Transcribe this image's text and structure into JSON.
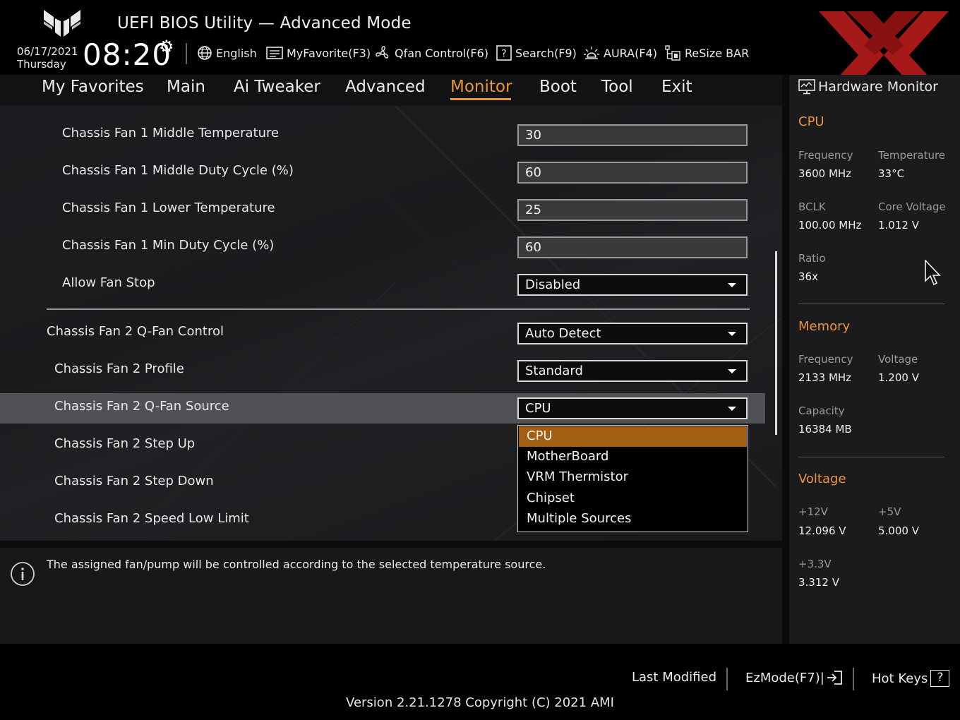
{
  "header": {
    "title": "UEFI BIOS Utility — Advanced Mode",
    "date": "06/17/2021",
    "day": "Thursday",
    "time": "08:20",
    "tools": [
      {
        "label": "English",
        "icon": "globe-icon"
      },
      {
        "label": "MyFavorite(F3)",
        "icon": "favorite-list-icon"
      },
      {
        "label": "Qfan Control(F6)",
        "icon": "fan-icon"
      },
      {
        "label": "Search(F9)",
        "icon": "search-help-icon"
      },
      {
        "label": "AURA(F4)",
        "icon": "aura-light-icon"
      },
      {
        "label": "ReSize BAR",
        "icon": "resize-bar-icon"
      }
    ]
  },
  "nav": {
    "tabs": [
      "My Favorites",
      "Main",
      "Ai Tweaker",
      "Advanced",
      "Monitor",
      "Boot",
      "Tool",
      "Exit"
    ],
    "active": "Monitor"
  },
  "settings": {
    "fan1": [
      {
        "label": "Chassis Fan 1 Middle Temperature",
        "value": "30",
        "kind": "text"
      },
      {
        "label": "Chassis Fan 1 Middle Duty Cycle (%)",
        "value": "60",
        "kind": "text"
      },
      {
        "label": "Chassis Fan 1 Lower Temperature",
        "value": "25",
        "kind": "text"
      },
      {
        "label": "Chassis Fan 1 Min Duty Cycle (%)",
        "value": "60",
        "kind": "text"
      },
      {
        "label": "Allow Fan Stop",
        "value": "Disabled",
        "kind": "select"
      }
    ],
    "fan2_control": {
      "label": "Chassis Fan 2 Q-Fan Control",
      "value": "Auto Detect"
    },
    "fan2_profile": {
      "label": "Chassis Fan 2 Profile",
      "value": "Standard"
    },
    "fan2_source": {
      "label": "Chassis Fan 2 Q-Fan Source",
      "value": "CPU"
    },
    "fan2_step_up": {
      "label": "Chassis Fan 2 Step Up"
    },
    "fan2_step_down": {
      "label": "Chassis Fan 2 Step Down"
    },
    "fan2_speed_low": {
      "label": "Chassis Fan 2 Speed Low Limit"
    }
  },
  "dropdown": {
    "options": [
      "CPU",
      "MotherBoard",
      "VRM Thermistor",
      "Chipset",
      "Multiple Sources"
    ],
    "selected": "CPU"
  },
  "help": {
    "text": "The assigned fan/pump will be controlled according to the selected temperature source."
  },
  "hardware_monitor": {
    "title": "Hardware Monitor",
    "cpu": {
      "heading": "CPU",
      "frequency_label": "Frequency",
      "frequency": "3600 MHz",
      "temperature_label": "Temperature",
      "temperature": "33°C",
      "bclk_label": "BCLK",
      "bclk": "100.00 MHz",
      "core_voltage_label": "Core Voltage",
      "core_voltage": "1.012 V",
      "ratio_label": "Ratio",
      "ratio": "36x"
    },
    "memory": {
      "heading": "Memory",
      "frequency_label": "Frequency",
      "frequency": "2133 MHz",
      "voltage_label": "Voltage",
      "voltage": "1.200 V",
      "capacity_label": "Capacity",
      "capacity": "16384 MB"
    },
    "voltage": {
      "heading": "Voltage",
      "v12_label": "+12V",
      "v12": "12.096 V",
      "v5_label": "+5V",
      "v5": "5.000 V",
      "v33_label": "+3.3V",
      "v33": "3.312 V"
    }
  },
  "footer": {
    "last_modified": "Last Modified",
    "ezmode": "EzMode(F7)|",
    "hotkeys": "Hot Keys",
    "hotkeys_glyph": "?",
    "version": "Version 2.21.1278 Copyright (C) 2021 AMI"
  },
  "colors": {
    "accent": "#e8943a",
    "dropdown_selected": "#a15f14",
    "highlight_row": "#505154"
  }
}
